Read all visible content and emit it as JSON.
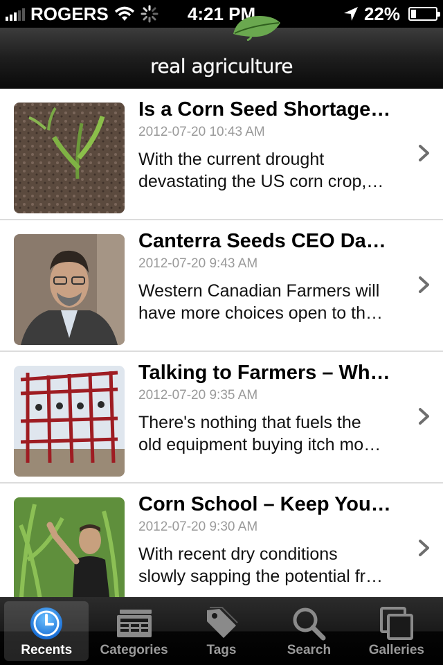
{
  "status_bar": {
    "carrier": "ROGERS",
    "time": "4:21 PM",
    "battery": "22%",
    "battery_level": 0.22
  },
  "header": {
    "logo_text": "real agriculture",
    "logo_color": "#5a9a3a"
  },
  "articles": [
    {
      "title": "Is a Corn Seed Shortage…",
      "date": "2012-07-20 10:43 AM",
      "summary_line1": "With the current drought",
      "summary_line2": "devastating the US corn crop,…",
      "thumb": "corn-seedling-photo"
    },
    {
      "title": "Canterra Seeds CEO Da…",
      "date": "2012-07-20 9:43 AM",
      "summary_line1": "Western Canadian Farmers will",
      "summary_line2": "have more choices open to th…",
      "thumb": "ceo-portrait-photo"
    },
    {
      "title": "Talking to Farmers – Wh…",
      "date": "2012-07-20 9:35 AM",
      "summary_line1": "There's nothing that fuels the",
      "summary_line2": "old equipment buying itch mo…",
      "thumb": "red-farm-equipment-photo"
    },
    {
      "title": "Corn School – Keep You…",
      "date": "2012-07-20 9:30 AM",
      "summary_line1": "With recent dry conditions",
      "summary_line2": "slowly sapping the potential fr…",
      "thumb": "man-in-corn-field-photo"
    }
  ],
  "tabs": [
    {
      "label": "Recents",
      "icon": "clock-icon",
      "active": true
    },
    {
      "label": "Categories",
      "icon": "newspaper-icon",
      "active": false
    },
    {
      "label": "Tags",
      "icon": "tag-icon",
      "active": false
    },
    {
      "label": "Search",
      "icon": "search-icon",
      "active": false
    },
    {
      "label": "Galleries",
      "icon": "gallery-icon",
      "active": false
    }
  ]
}
